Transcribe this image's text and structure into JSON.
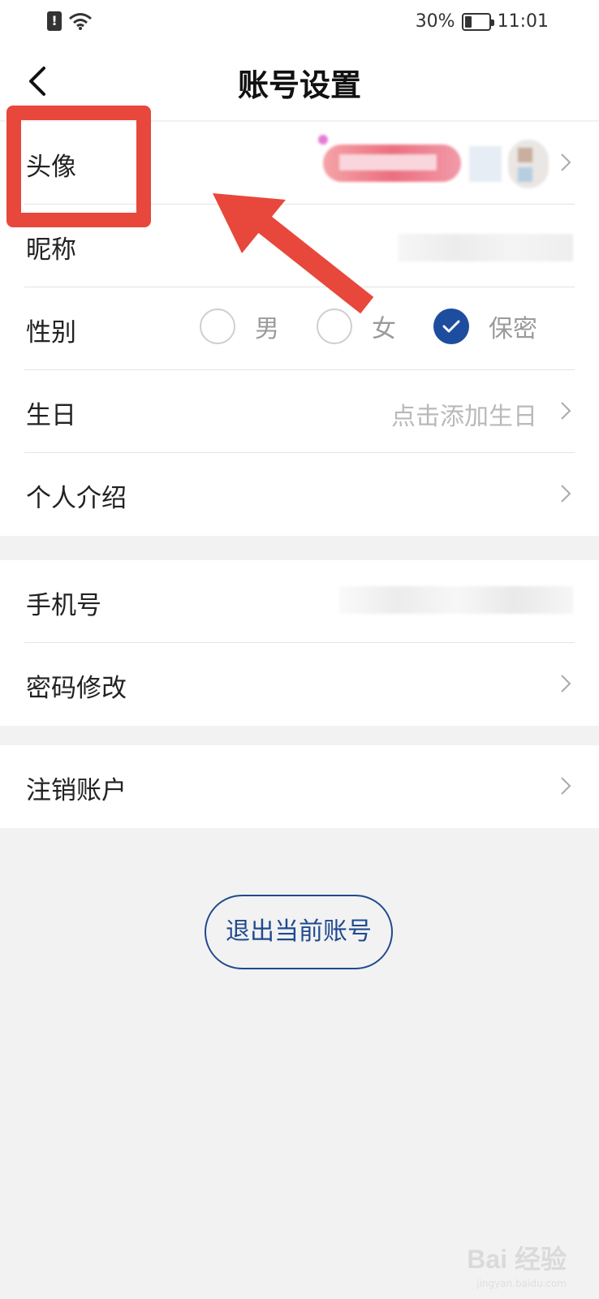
{
  "status_bar": {
    "battery": "30%",
    "battery_level": 0.3,
    "time": "11:01",
    "alert_glyph": "!"
  },
  "header": {
    "title": "账号设置"
  },
  "profile": {
    "avatar_label": "头像",
    "nickname_label": "昵称",
    "gender": {
      "label": "性别",
      "options": [
        "男",
        "女",
        "保密"
      ],
      "selected": "保密"
    },
    "birthday": {
      "label": "生日",
      "hint": "点击添加生日"
    },
    "intro_label": "个人介绍"
  },
  "account": {
    "phone_label": "手机号",
    "password_label": "密码修改"
  },
  "deactivate": {
    "label": "注销账户"
  },
  "logout_label": "退出当前账号",
  "watermark": {
    "main": "Bai 经验",
    "sub": "jingyan.baidu.com"
  },
  "colors": {
    "accent": "#1d4d9e",
    "annotation": "#e8473b",
    "background": "#f2f2f2"
  },
  "icons": [
    "alert-icon",
    "wifi-icon",
    "battery-icon",
    "back-arrow-icon",
    "chevron-right-icon",
    "check-icon"
  ]
}
